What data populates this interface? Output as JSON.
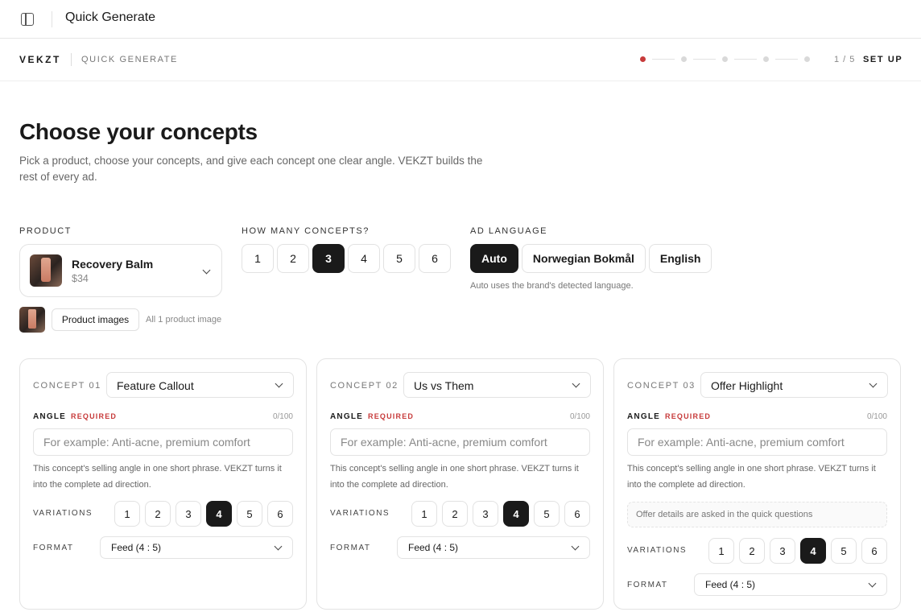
{
  "topbar": {
    "title": "Quick Generate"
  },
  "subbar": {
    "brand": "VEKZT",
    "section": "QUICK GENERATE",
    "step_count": "1 / 5",
    "step_label": "SET UP",
    "progress": {
      "current": 1,
      "total": 5,
      "active_color": "#c73a3a"
    }
  },
  "heading": "Choose your concepts",
  "description": "Pick a product, choose your concepts, and give each concept one clear angle. VEKZT builds the rest of every ad.",
  "product": {
    "label": "PRODUCT",
    "name": "Recovery Balm",
    "price": "$34",
    "images_button": "Product images",
    "images_note": "All 1 product image"
  },
  "concepts_count": {
    "label": "HOW MANY CONCEPTS?",
    "options": [
      "1",
      "2",
      "3",
      "4",
      "5",
      "6"
    ],
    "selected": "3"
  },
  "language": {
    "label": "AD LANGUAGE",
    "options": [
      "Auto",
      "Norwegian Bokmål",
      "English"
    ],
    "selected": "Auto",
    "note": "Auto uses the brand's detected language."
  },
  "concepts": [
    {
      "label": "CONCEPT 01",
      "type": "Feature Callout",
      "angle_label": "ANGLE",
      "required": "REQUIRED",
      "char_count": "0/100",
      "angle_placeholder": "For example: Anti-acne, premium comfort",
      "help": "This concept's selling angle in one short phrase. VEKZT turns it into the complete ad direction.",
      "variations_label": "VARIATIONS",
      "variations": [
        "1",
        "2",
        "3",
        "4",
        "5",
        "6"
      ],
      "selected_variation": "4",
      "format_label": "FORMAT",
      "format": "Feed (4 : 5)"
    },
    {
      "label": "CONCEPT 02",
      "type": "Us vs Them",
      "angle_label": "ANGLE",
      "required": "REQUIRED",
      "char_count": "0/100",
      "angle_placeholder": "For example: Anti-acne, premium comfort",
      "help": "This concept's selling angle in one short phrase. VEKZT turns it into the complete ad direction.",
      "variations_label": "VARIATIONS",
      "variations": [
        "1",
        "2",
        "3",
        "4",
        "5",
        "6"
      ],
      "selected_variation": "4",
      "format_label": "FORMAT",
      "format": "Feed (4 : 5)"
    },
    {
      "label": "CONCEPT 03",
      "type": "Offer Highlight",
      "angle_label": "ANGLE",
      "required": "REQUIRED",
      "char_count": "0/100",
      "angle_placeholder": "For example: Anti-acne, premium comfort",
      "help": "This concept's selling angle in one short phrase. VEKZT turns it into the complete ad direction.",
      "offer_note": "Offer details are asked in the quick questions",
      "variations_label": "VARIATIONS",
      "variations": [
        "1",
        "2",
        "3",
        "4",
        "5",
        "6"
      ],
      "selected_variation": "4",
      "format_label": "FORMAT",
      "format": "Feed (4 : 5)"
    }
  ]
}
